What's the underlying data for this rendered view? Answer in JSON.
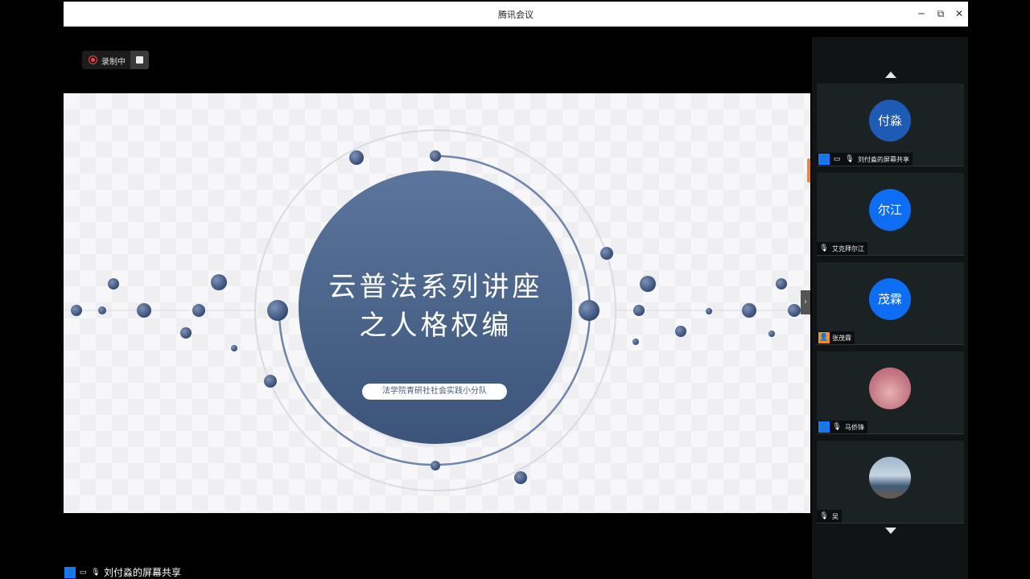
{
  "window": {
    "title": "腾讯会议",
    "minimize": "─",
    "restore": "⧉",
    "close": "✕"
  },
  "recording": {
    "label": "录制中"
  },
  "slide": {
    "title_line1": "云普法系列讲座",
    "title_line2": "之人格权编",
    "subtitle": "法学院青研社社会实践小分队"
  },
  "participants": [
    {
      "avatar_text": "付淼",
      "name": "刘付淼的屏幕共享"
    },
    {
      "avatar_text": "尔江",
      "name": "艾克拜尔江"
    },
    {
      "avatar_text": "茂霖",
      "name": "张茂霖"
    },
    {
      "avatar_text": "",
      "name": "马侨锋"
    },
    {
      "avatar_text": "",
      "name": "吴"
    }
  ],
  "share_label": "刘付淼的屏幕共享",
  "colors": {
    "accent": "#1677ff",
    "slide_circle": "#4a6590"
  }
}
